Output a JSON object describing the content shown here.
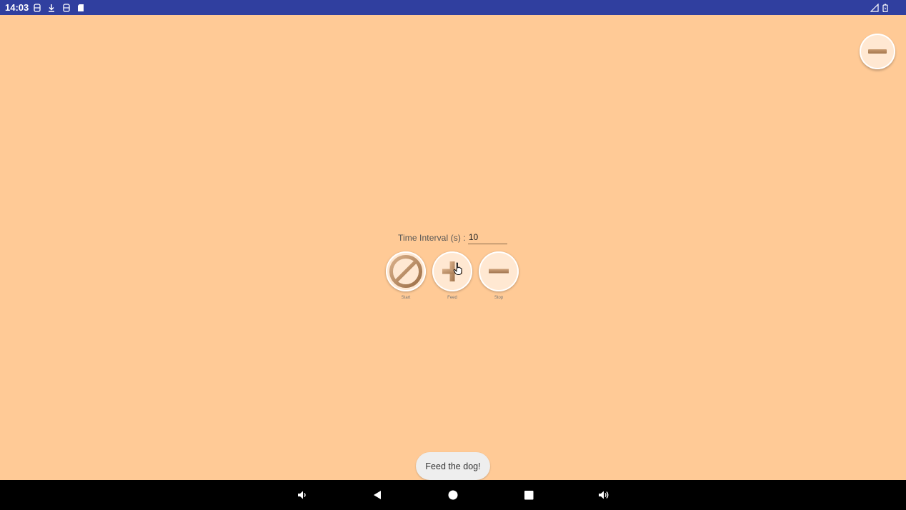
{
  "status_bar": {
    "time": "14:03",
    "left_icons": [
      "sim-icon",
      "download-icon",
      "sim-icon",
      "sd-card-icon"
    ],
    "right_icons": [
      "signal-icon",
      "battery-icon"
    ],
    "background": "#303F9F"
  },
  "app": {
    "background": "#FFCA96",
    "interval": {
      "label": "Time Interval (s) :",
      "value": "10"
    },
    "buttons": [
      {
        "icon": "no-entry-icon",
        "label": "Start"
      },
      {
        "icon": "plus-icon",
        "label": "Feed"
      },
      {
        "icon": "minus-icon",
        "label": "Stop"
      }
    ],
    "floating_button_icon": "minus-icon",
    "toast": "Feed the dog!"
  },
  "nav_bar": {
    "buttons": [
      "volume-down-icon",
      "back-icon",
      "home-icon",
      "recents-icon",
      "volume-up-icon"
    ]
  }
}
